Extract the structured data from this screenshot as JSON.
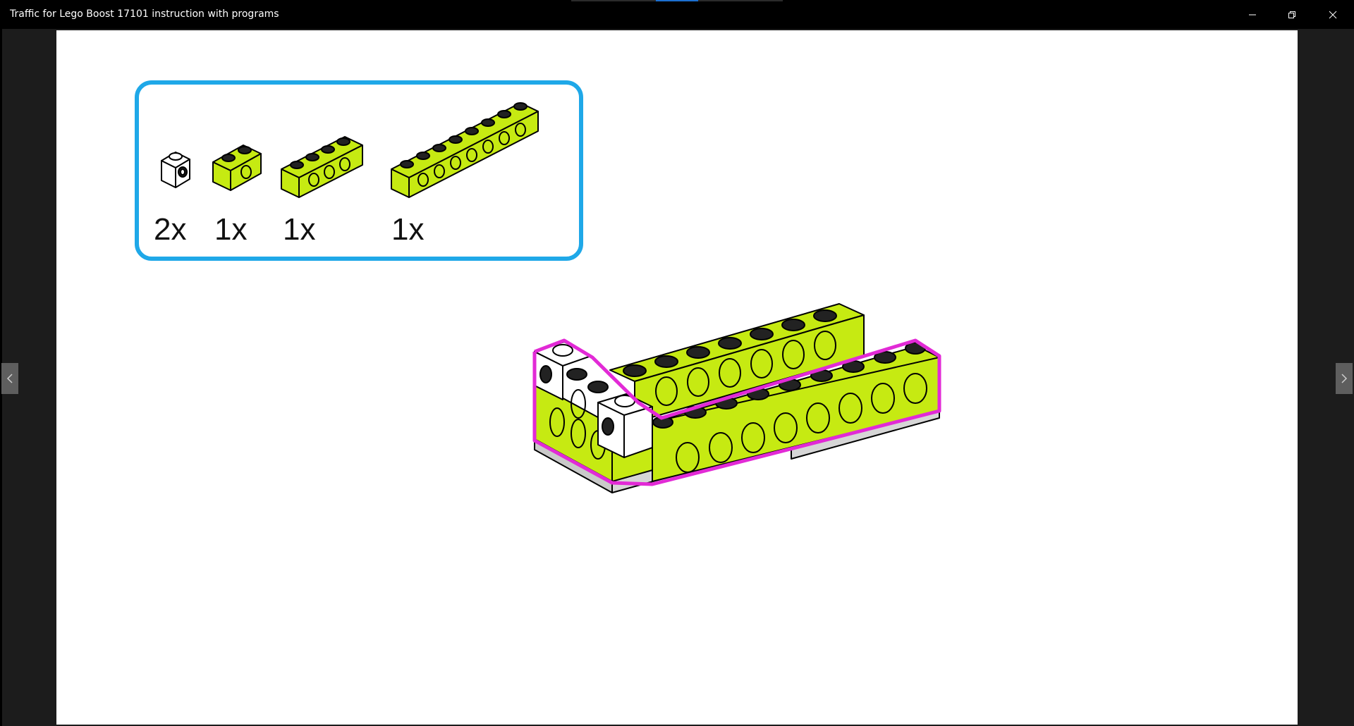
{
  "window": {
    "title": "Traffic for Lego Boost 17101 instruction with programs",
    "controls": {
      "minimize_icon": "minimize-icon",
      "maximize_icon": "restore-icon",
      "close_icon": "close-icon"
    }
  },
  "navigation": {
    "prev_icon": "chevron-left-icon",
    "next_icon": "chevron-right-icon"
  },
  "parts_list": {
    "border_color": "#1fa8e8",
    "items": [
      {
        "part": "white-1x1-technic-brick",
        "quantity": "2x"
      },
      {
        "part": "lime-1x2-technic-brick",
        "quantity": "1x"
      },
      {
        "part": "lime-1x4-technic-brick",
        "quantity": "1x"
      },
      {
        "part": "lime-1x8-technic-brick",
        "quantity": "1x"
      }
    ]
  },
  "colors": {
    "lime": "#c6ea12",
    "highlight": "#e22ad6",
    "plate": "#c9c9c9"
  }
}
